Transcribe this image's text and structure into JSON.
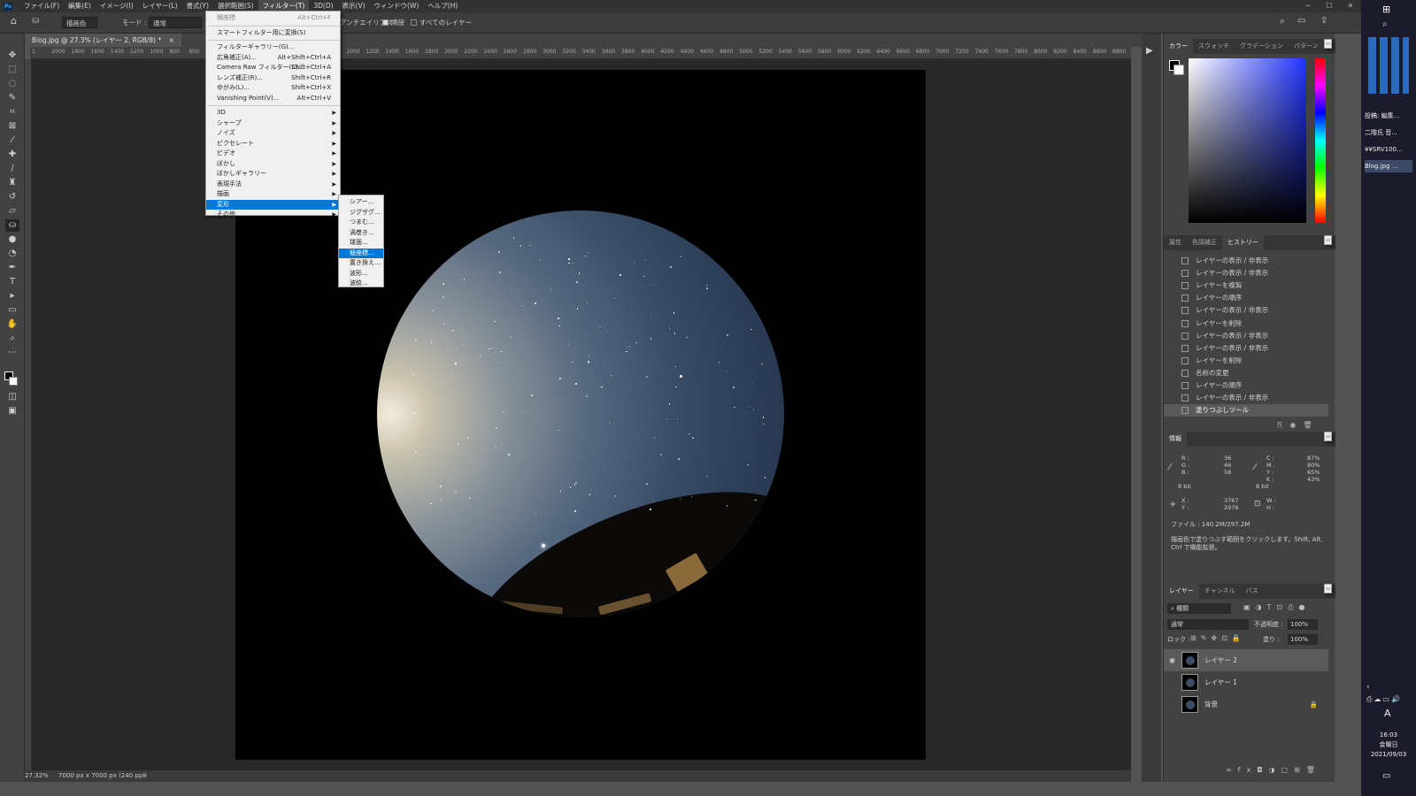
{
  "menubar": {
    "items": [
      "ファイル(F)",
      "編集(E)",
      "イメージ(I)",
      "レイヤー(L)",
      "書式(Y)",
      "選択範囲(S)",
      "フィルター(T)",
      "3D(D)",
      "表示(V)",
      "ウィンドウ(W)",
      "ヘルプ(H)"
    ],
    "active_index": 6
  },
  "options": {
    "fill_source": "描画色",
    "mode_label": "モード :",
    "mode_value": "通常",
    "antialias": "アンチエイリアス",
    "contiguous": "隣接",
    "all_layers": "すべてのレイヤー"
  },
  "document": {
    "tab_title": "Blog.jpg @ 27.3% (レイヤー 2, RGB/8) *",
    "zoom": "27.32%",
    "size_info": "7000 px x 7000 px (240 ppi)"
  },
  "ruler_ticks": [
    "1",
    "2000",
    "1800",
    "1600",
    "1400",
    "1200",
    "1000",
    "800",
    "600",
    "400",
    "200",
    "0",
    "200",
    "400",
    "600",
    "800",
    "1000",
    "1200",
    "1400",
    "1600",
    "1800",
    "2000",
    "2200",
    "2400",
    "2600",
    "2800",
    "3000",
    "3200",
    "3400",
    "3600",
    "3800",
    "4000",
    "4200",
    "4400",
    "4600",
    "4800",
    "5000",
    "5200",
    "5400",
    "5600",
    "5800",
    "6000",
    "6200",
    "6400",
    "6600",
    "6800",
    "7000",
    "7200",
    "7400",
    "7600",
    "7800",
    "8000",
    "8200",
    "8400",
    "8600",
    "8800"
  ],
  "filter_menu": {
    "items": [
      {
        "label": "横座標",
        "shortcut": "Alt+Ctrl+F",
        "disabled": true
      },
      {
        "label": "スマートフィルター用に変換(S)",
        "shortcut": ""
      },
      {
        "label": "フィルターギャラリー(G)...",
        "shortcut": ""
      },
      {
        "label": "広角補正(A)...",
        "shortcut": "Alt+Shift+Ctrl+A"
      },
      {
        "label": "Camera Raw フィルター(C)...",
        "shortcut": "Shift+Ctrl+A"
      },
      {
        "label": "レンズ補正(R)...",
        "shortcut": "Shift+Ctrl+R"
      },
      {
        "label": "ゆがみ(L)...",
        "shortcut": "Shift+Ctrl+X"
      },
      {
        "label": "Vanishing Point(V)...",
        "shortcut": "Alt+Ctrl+V"
      },
      {
        "label": "3D",
        "submenu": true
      },
      {
        "label": "シャープ",
        "submenu": true
      },
      {
        "label": "ノイズ",
        "submenu": true
      },
      {
        "label": "ピクセレート",
        "submenu": true
      },
      {
        "label": "ビデオ",
        "submenu": true
      },
      {
        "label": "ぼかし",
        "submenu": true
      },
      {
        "label": "ぼかしギャラリー",
        "submenu": true
      },
      {
        "label": "表現手法",
        "submenu": true
      },
      {
        "label": "描画",
        "submenu": true
      },
      {
        "label": "変形",
        "submenu": true,
        "highlighted": true
      },
      {
        "label": "その他",
        "submenu": true
      }
    ]
  },
  "distort_submenu": {
    "items": [
      "シアー...",
      "ジグザグ...",
      "つまむ...",
      "渦巻き...",
      "球面...",
      "極座標...",
      "置き換え...",
      "波形...",
      "波紋..."
    ],
    "highlighted_index": 5
  },
  "color_panel": {
    "tabs": [
      "カラー",
      "スウォッチ",
      "グラデーション",
      "パターン"
    ]
  },
  "history_panel": {
    "tabs": [
      "属性",
      "色調補正",
      "ヒストリー"
    ],
    "items": [
      "レイヤーの表示 / 非表示",
      "レイヤーの表示 / 非表示",
      "レイヤーを複製",
      "レイヤーの順序",
      "レイヤーの表示 / 非表示",
      "レイヤーを削除",
      "レイヤーの表示 / 非表示",
      "レイヤーの表示 / 非表示",
      "レイヤーを削除",
      "名前の変更",
      "レイヤーの順序",
      "レイヤーの表示 / 非表示",
      "塗りつぶしツール"
    ]
  },
  "info_panel": {
    "title": "情報",
    "R": "36",
    "G": "46",
    "B": "58",
    "C": "87%",
    "M": "80%",
    "Y": "65%",
    "K": "43%",
    "bit_left": "8 bit",
    "bit_right": "8 bit",
    "X": "3767",
    "Ycoord": "2976",
    "file": "ファイル : 140.2M/297.2M",
    "hint": "描画色で塗りつぶす範囲をクリックします。Shift, Alt, Ctrl で機能拡張。"
  },
  "layers_panel": {
    "tabs": [
      "レイヤー",
      "チャンネル",
      "パス"
    ],
    "filter": "種類",
    "blend": "通常",
    "opacity_label": "不透明度 :",
    "opacity": "100%",
    "lock_label": "ロック :",
    "fill_label": "塗り :",
    "fill": "100%",
    "layers": [
      {
        "name": "レイヤー 2",
        "visible": true,
        "selected": true
      },
      {
        "name": "レイヤー 1",
        "visible": false
      },
      {
        "name": "背景",
        "visible": false,
        "locked": true
      }
    ]
  },
  "taskbar": {
    "items": [
      "投稿: 編集...",
      "二階氏 音...",
      "¥¥SRV100...",
      "Blog.jpg ..."
    ],
    "time": "16:03",
    "weekday": "金曜日",
    "date": "2021/09/03",
    "ime": "A"
  }
}
